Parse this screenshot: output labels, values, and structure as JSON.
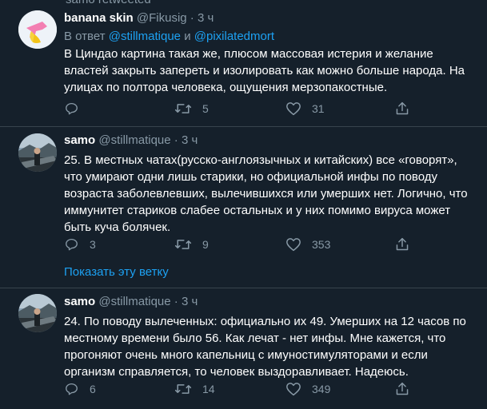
{
  "top_cut_text": "samo retweeted",
  "tweets": [
    {
      "name": "banana skin",
      "handle": "@Fikusig",
      "time": "3 ч",
      "reply_prefix": "В ответ",
      "reply_user1": "@stillmatique",
      "reply_and": "и",
      "reply_user2": "@pixilatedmort",
      "text": "В Циндао картина такая же, плюсом массовая истерия и желание властей закрыть запереть и изолировать как можно больше народа. На улицах по полтора человека, ощущения мерзопакостные.",
      "reply_count": "",
      "retweet_count": "5",
      "like_count": "31"
    },
    {
      "name": "samo",
      "handle": "@stillmatique",
      "time": "3 ч",
      "text": "25. В местных чатах(русско-англоязычных и китайских) все «говорят», что умирают одни лишь старики, но официальной инфы по поводу возраста заболевлевших, вылечившихся или умерших нет. Логично, что иммунитет стариков слабее остальных и у них помимо вируса может быть куча болячек.",
      "reply_count": "3",
      "retweet_count": "9",
      "like_count": "353",
      "show_thread": "Показать эту ветку"
    },
    {
      "name": "samo",
      "handle": "@stillmatique",
      "time": "3 ч",
      "text": "24. По поводу вылеченных: официально их 49. Умерших на 12 часов по местному времени было 56. Как лечат - нет инфы. Мне кажется, что прогоняют очень много капельниц с имуностимуляторами и если организм справляется, то человек выздоравливает. Надеюсь.",
      "reply_count": "6",
      "retweet_count": "14",
      "like_count": "349"
    }
  ],
  "colors": {
    "background": "#15202b",
    "secondary_text": "#8899a6",
    "link": "#1da1f2",
    "divider": "#38444d"
  }
}
